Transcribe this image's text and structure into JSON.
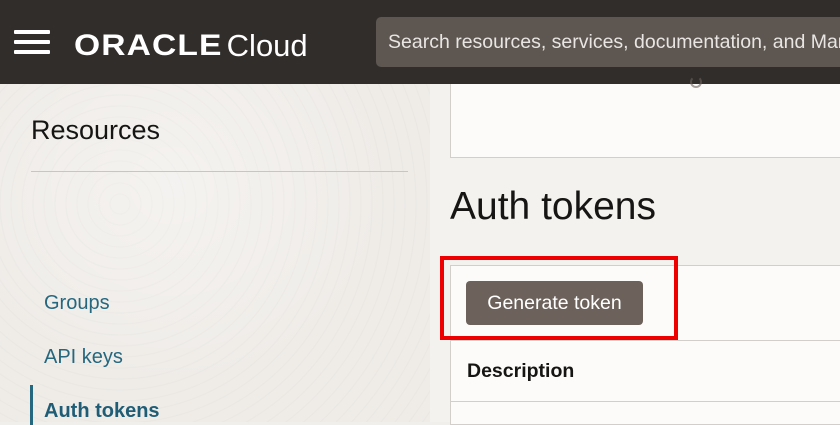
{
  "header": {
    "brand": "ORACLE",
    "product": "Cloud",
    "search_placeholder": "Search resources, services, documentation, and Marketplace"
  },
  "sidebar": {
    "title": "Resources",
    "items": [
      {
        "label": "Groups",
        "active": false
      },
      {
        "label": "API keys",
        "active": false
      },
      {
        "label": "Auth tokens",
        "active": true
      }
    ]
  },
  "main": {
    "title": "Auth tokens",
    "generate_button": "Generate token",
    "columns": [
      "Description"
    ]
  },
  "colors": {
    "topbar": "#312d2a",
    "search_bg": "#5d5651",
    "link": "#24677f",
    "button": "#6c625b",
    "highlight": "#ee0000"
  }
}
